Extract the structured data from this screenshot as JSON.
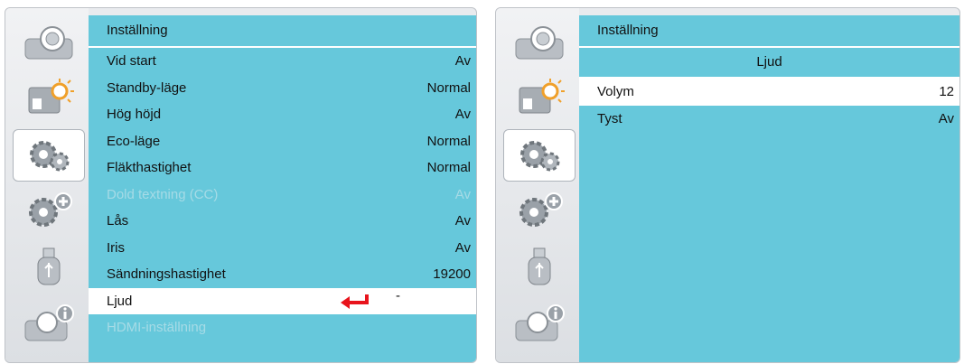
{
  "left": {
    "title": "Inställning",
    "items": [
      {
        "label": "Vid start",
        "value": "Av"
      },
      {
        "label": "Standby-läge",
        "value": "Normal"
      },
      {
        "label": "Hög höjd",
        "value": "Av"
      },
      {
        "label": "Eco-läge",
        "value": "Normal"
      },
      {
        "label": "Fläkthastighet",
        "value": "Normal"
      },
      {
        "label": "Dold textning (CC)",
        "value": "Av"
      },
      {
        "label": "Lås",
        "value": "Av"
      },
      {
        "label": "Iris",
        "value": "Av"
      },
      {
        "label": "Sändningshastighet",
        "value": "19200"
      },
      {
        "label": "Ljud",
        "value": "-"
      },
      {
        "label": "HDMI-inställning",
        "value": ""
      }
    ]
  },
  "right": {
    "title": "Inställning",
    "subtitle": "Ljud",
    "items": [
      {
        "label": "Volym",
        "value": "12"
      },
      {
        "label": "Tyst",
        "value": "Av"
      }
    ]
  },
  "colors": {
    "menu_bg": "#66c8db",
    "selected_row": "#ffffff",
    "disabled_text": "#a6dbe6",
    "enter_arrow": "#e8141c"
  },
  "icons": [
    "image-adjust-icon",
    "display-settings-icon",
    "setup-gears-icon",
    "advanced-setup-icon",
    "usb-icon",
    "information-icon"
  ]
}
